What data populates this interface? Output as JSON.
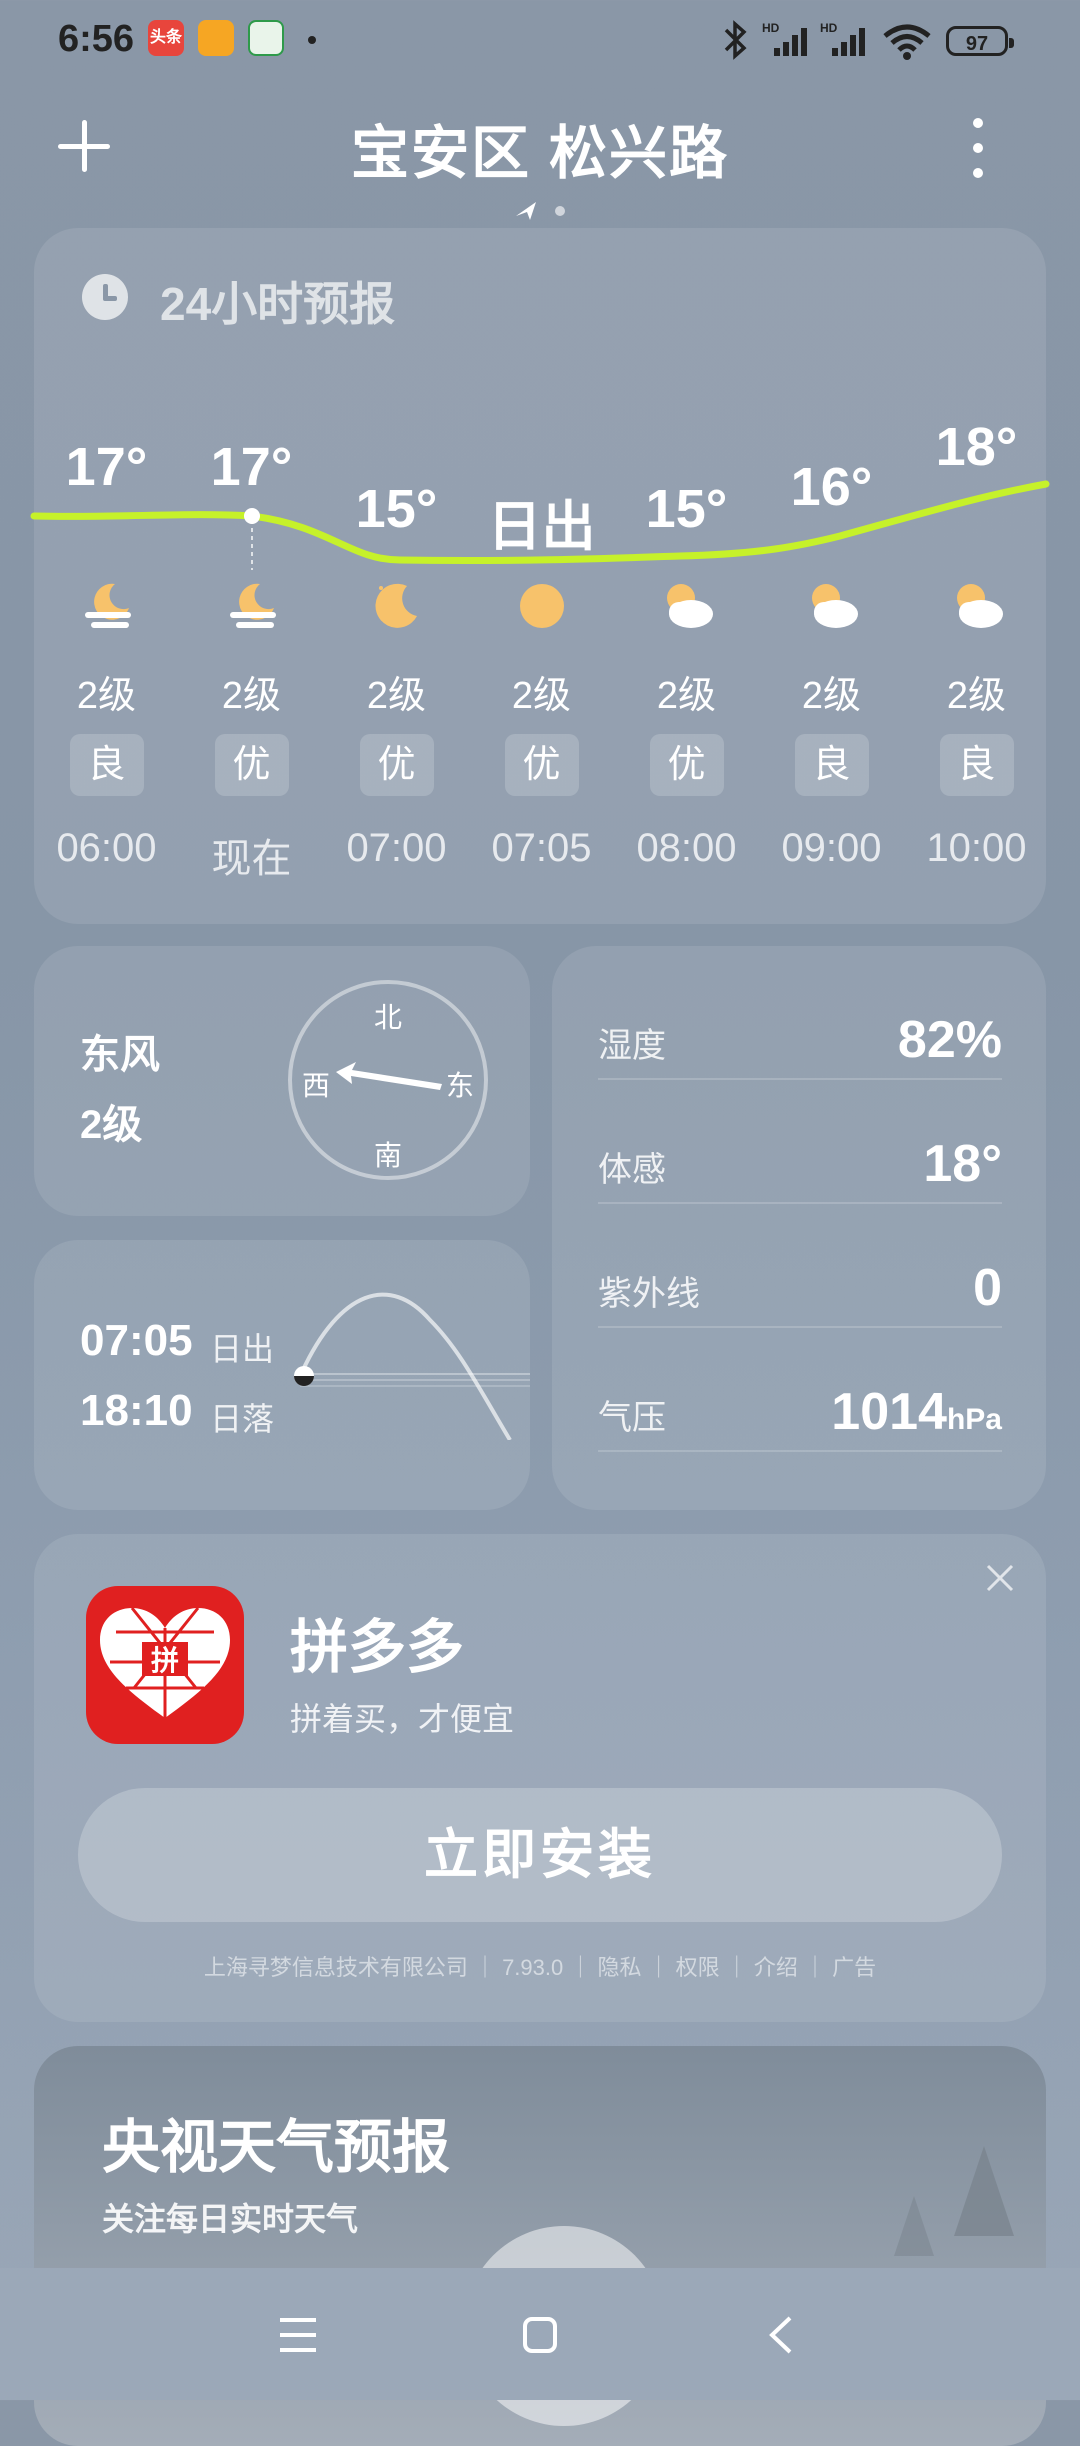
{
  "status_bar": {
    "time": "6:56",
    "notif_app1": "头条",
    "battery": "97"
  },
  "header": {
    "title": "宝安区 松兴路"
  },
  "forecast": {
    "title": "24小时预报",
    "columns": [
      {
        "temp": "17°",
        "wind": "2级",
        "aqi": "良",
        "hour": "06:00",
        "icon": "moon-cloud-icon"
      },
      {
        "temp": "17°",
        "wind": "2级",
        "aqi": "优",
        "hour": "现在",
        "icon": "moon-cloud-icon"
      },
      {
        "temp": "15°",
        "wind": "2级",
        "aqi": "优",
        "hour": "07:00",
        "icon": "crescent-moon-icon"
      },
      {
        "temp": "日出",
        "wind": "2级",
        "aqi": "优",
        "hour": "07:05",
        "icon": "sun-icon"
      },
      {
        "temp": "15°",
        "wind": "2级",
        "aqi": "优",
        "hour": "08:00",
        "icon": "partly-cloudy-icon"
      },
      {
        "temp": "16°",
        "wind": "2级",
        "aqi": "良",
        "hour": "09:00",
        "icon": "partly-cloudy-icon"
      },
      {
        "temp": "18°",
        "wind": "2级",
        "aqi": "良",
        "hour": "10:00",
        "icon": "partly-cloudy-icon"
      }
    ],
    "colors": {
      "curve": "#c6f12a",
      "sun": "#f7c26b"
    }
  },
  "wind_card": {
    "direction": "东风",
    "level": "2级",
    "compass": {
      "north": "北",
      "south": "南",
      "west": "西",
      "east": "东"
    }
  },
  "sun_card": {
    "sunrise_time": "07:05",
    "sunrise_label": "日出",
    "sunset_time": "18:10",
    "sunset_label": "日落"
  },
  "details": {
    "rows": [
      {
        "label": "湿度",
        "value": "82%"
      },
      {
        "label": "体感",
        "value": "18°"
      },
      {
        "label": "紫外线",
        "value": "0"
      },
      {
        "label": "气压",
        "value": "1014",
        "unit": "hPa"
      }
    ]
  },
  "ad": {
    "logo_text": "拼",
    "app_name": "拼多多",
    "slogan": "拼着买，才便宜",
    "install_label": "立即安装",
    "footer": "上海寻梦信息技术有限公司 ｜ 7.93.0 ｜ 隐私 ｜ 权限 ｜ 介绍 ｜ 广告",
    "brand_color": "#e02020"
  },
  "cctv": {
    "title": "央视天气预报",
    "subtitle": "关注每日实时天气"
  }
}
